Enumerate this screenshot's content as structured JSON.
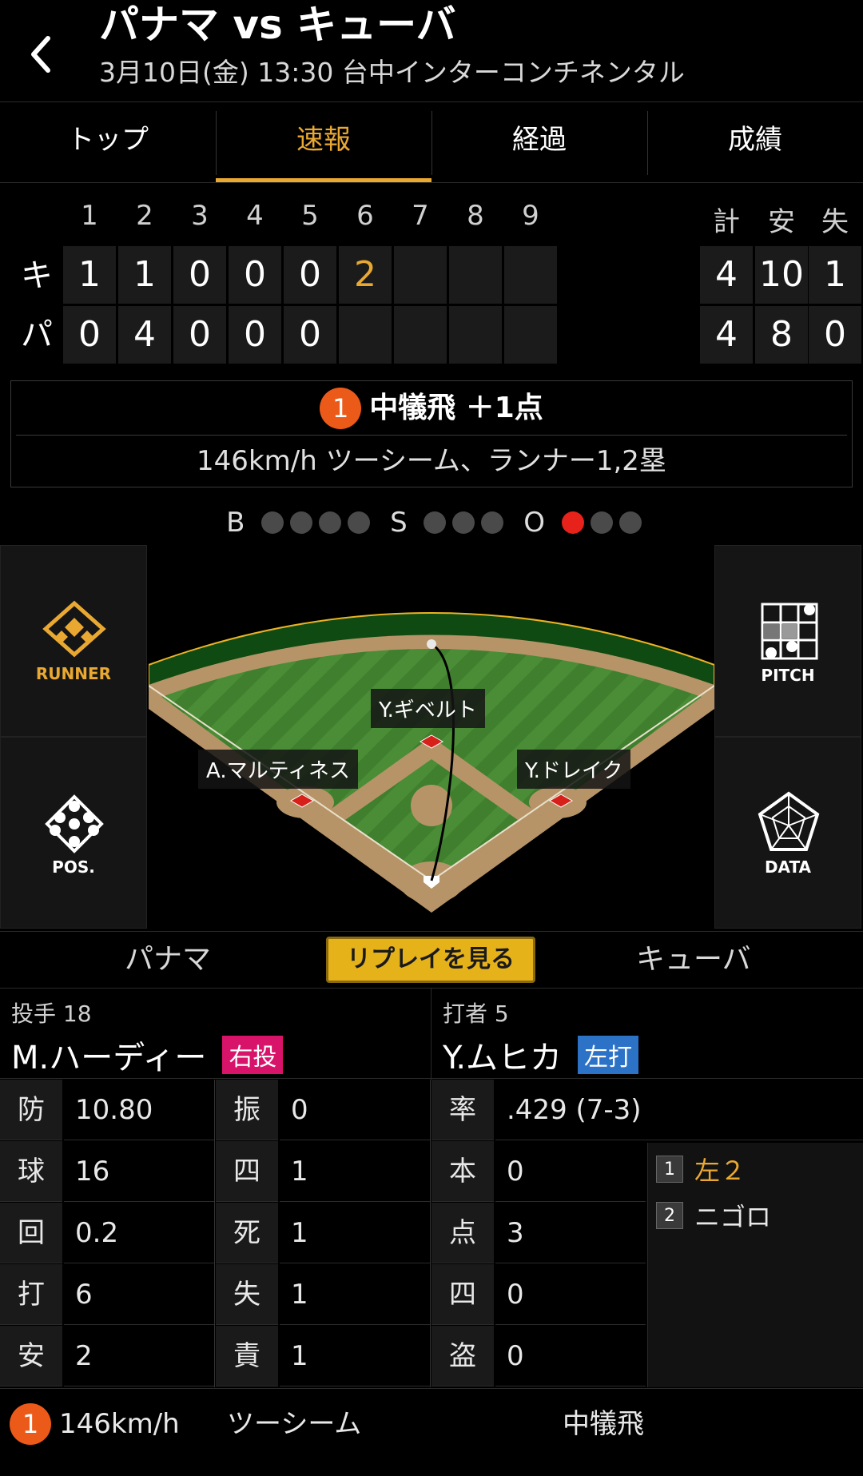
{
  "header": {
    "title": "パナマ vs キューバ",
    "subtitle": "3月10日(金) 13:30 台中インターコンチネンタル"
  },
  "tabs": [
    {
      "label": "トップ",
      "active": false
    },
    {
      "label": "速報",
      "active": true
    },
    {
      "label": "経過",
      "active": false
    },
    {
      "label": "成績",
      "active": false
    }
  ],
  "scoreboard": {
    "innings": [
      "1",
      "2",
      "3",
      "4",
      "5",
      "6",
      "7",
      "8",
      "9"
    ],
    "totals_headers": [
      "計",
      "安",
      "失"
    ],
    "teams": [
      {
        "abbr": "キ",
        "innings": [
          "1",
          "1",
          "0",
          "0",
          "0",
          "2",
          "",
          "",
          ""
        ],
        "highlight_inning": 6,
        "totals": [
          "4",
          "10",
          "1"
        ]
      },
      {
        "abbr": "パ",
        "innings": [
          "0",
          "4",
          "0",
          "0",
          "0",
          "",
          "",
          "",
          ""
        ],
        "totals": [
          "4",
          "8",
          "0"
        ]
      }
    ]
  },
  "play": {
    "number": "1",
    "title": "中犠飛 ＋1点",
    "detail": "146km/h ツーシーム、ランナー1,2塁"
  },
  "count": {
    "ball_label": "B",
    "balls": 0,
    "balls_max": 4,
    "strike_label": "S",
    "strikes": 0,
    "strikes_max": 3,
    "out_label": "O",
    "outs": 1,
    "outs_max": 3
  },
  "side_buttons": {
    "runner": "RUNNER",
    "pos": "POS.",
    "pitch": "PITCH",
    "data": "DATA"
  },
  "fielders": {
    "center": "Y.ギベルト",
    "left": "A.マルティネス",
    "right": "Y.ドレイク"
  },
  "team_row": {
    "left": "パナマ",
    "replay": "リプレイを見る",
    "right": "キューバ"
  },
  "pitcher": {
    "role": "投手 18",
    "name": "M.ハーディー",
    "hand": "右投",
    "stats": [
      {
        "k": "防",
        "v": "10.80"
      },
      {
        "k": "球",
        "v": "16"
      },
      {
        "k": "回",
        "v": "0.2"
      },
      {
        "k": "打",
        "v": "6"
      },
      {
        "k": "安",
        "v": "2"
      }
    ],
    "stats2": [
      {
        "k": "振",
        "v": "0"
      },
      {
        "k": "四",
        "v": "1"
      },
      {
        "k": "死",
        "v": "1"
      },
      {
        "k": "失",
        "v": "1"
      },
      {
        "k": "責",
        "v": "1"
      }
    ]
  },
  "batter": {
    "role": "打者 5",
    "name": "Y.ムヒカ",
    "hand": "左打",
    "stats": [
      {
        "k": "率",
        "v": ".429 (7-3)"
      },
      {
        "k": "本",
        "v": "0"
      },
      {
        "k": "点",
        "v": "3"
      },
      {
        "k": "四",
        "v": "0"
      },
      {
        "k": "盗",
        "v": "0"
      }
    ],
    "at_bats": [
      {
        "n": "1",
        "result": "左２",
        "highlight": true
      },
      {
        "n": "2",
        "result": "ニゴロ",
        "highlight": false
      }
    ]
  },
  "footer": {
    "number": "1",
    "speed": "146km/h",
    "pitch": "ツーシーム",
    "result": "中犠飛"
  },
  "colors": {
    "accent": "#e9a832",
    "badge": "#ec5a1a",
    "out_on": "#e6221a",
    "right_hand": "#d8146a",
    "left_hand": "#2c73c8"
  }
}
